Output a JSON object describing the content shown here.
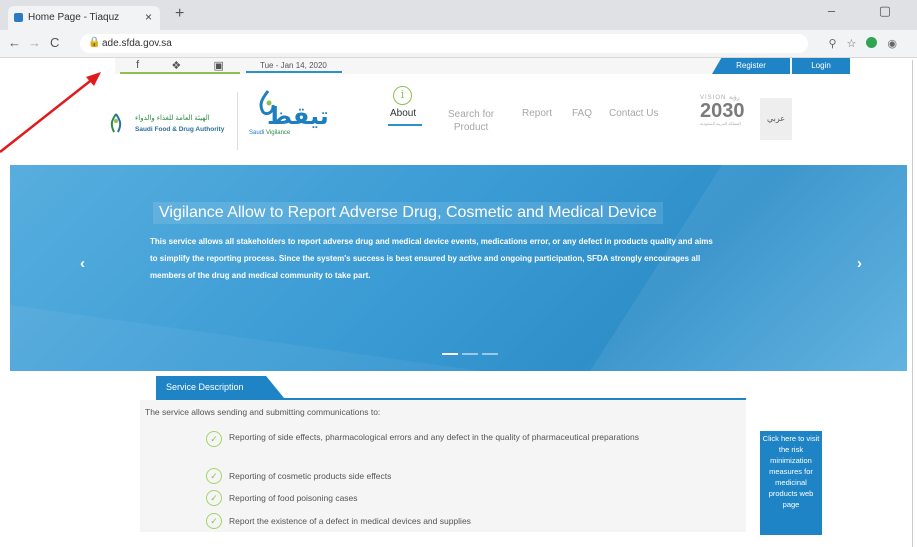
{
  "browser": {
    "tab_title": "Home Page - Tiaquz",
    "tab_close": "×",
    "new_tab": "+",
    "url": "ade.sfda.gov.sa",
    "win_controls": "–  ▢",
    "nav_back": "←",
    "nav_forward": "→",
    "nav_reload": "C",
    "icons": [
      "zoom-icon",
      "star-icon",
      "extension-icon",
      "profile-icon"
    ]
  },
  "topbar": {
    "social": [
      "f",
      "✔",
      "▣"
    ],
    "date": "Tue - Jan 14, 2020",
    "register": "Register",
    "login": "Login"
  },
  "header": {
    "sfda_ar": "الهيئة العامة للغذاء والدواء",
    "sfda_en": "Saudi Food & Drug Authority",
    "logo_ar": "تيقظ",
    "logo_en_1": "Saudi ",
    "logo_en_2": "Vigilance",
    "nav": {
      "about": "About",
      "search_1": "Search for",
      "search_2": "Product",
      "report": "Report",
      "faq": "FAQ",
      "contact": "Contact Us"
    },
    "vision_top": "VISION رؤية",
    "vision_year": "2030",
    "vision_sub": "المملكة العربية السعودية",
    "lang": "عربي"
  },
  "hero": {
    "title": "Vigilance Allow to Report Adverse Drug, Cosmetic and Medical Device",
    "text": "This service allows all stakeholders to report adverse drug and medical device events, medications error, or any defect in products quality and aims to simplify the reporting process. Since the system's success is best ensured by active and ongoing participation, SFDA strongly encourages all members of the drug and medical community to take part.",
    "prev": "‹",
    "next": "›"
  },
  "service": {
    "tab": "Service Description",
    "intro": "The service allows sending and submitting communications to:",
    "items": [
      "Reporting of side effects, pharmacological errors and any defect in the quality of pharmaceutical preparations",
      "Reporting of cosmetic products side effects",
      "Reporting of food poisoning cases",
      "Report the existence of a defect in medical devices and supplies"
    ],
    "risk_link": "Click here to visit the risk minimization measures for medicinal products web page"
  },
  "colors": {
    "brand_blue": "#1f84c6",
    "brand_green": "#8cc152",
    "annotation_arrow": "#e11b1b"
  }
}
